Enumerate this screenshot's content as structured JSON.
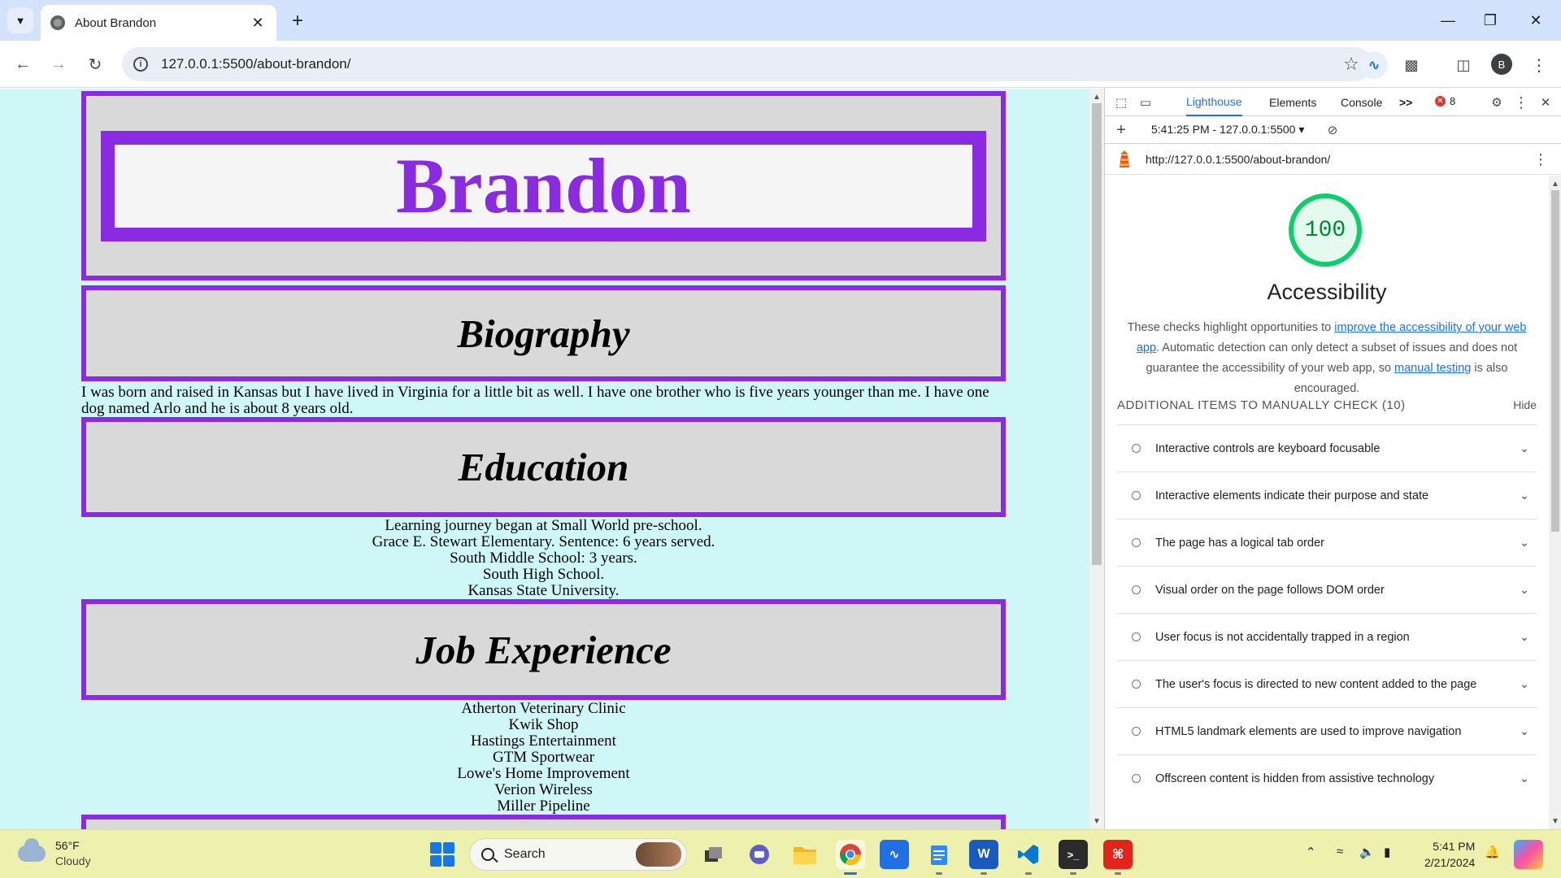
{
  "browser": {
    "tab_title": "About Brandon",
    "url": "127.0.0.1:5500/about-brandon/",
    "profile_initial": "B"
  },
  "page": {
    "site_title": "Brandon",
    "sections": {
      "biography": {
        "heading": "Biography",
        "text": "I was born and raised in Kansas but I have lived in Virginia for a little bit as well. I have one brother who is five years younger than me. I have one dog named Arlo and he is about 8 years old."
      },
      "education": {
        "heading": "Education",
        "lines": [
          "Learning journey began at Small World pre-school.",
          "Grace E. Stewart Elementary. Sentence: 6 years served.",
          "South Middle School: 3 years.",
          "South High School.",
          "Kansas State University."
        ]
      },
      "job_experience": {
        "heading": "Job Experience",
        "lines": [
          "Atherton Veterinary Clinic",
          "Kwik Shop",
          "Hastings Entertainment",
          "GTM Sportwear",
          "Lowe's Home Improvement",
          "Verion Wireless",
          "Miller Pipeline"
        ]
      }
    },
    "colors": {
      "background": "#cff7f7",
      "accent": "#8a2be2",
      "box": "#d9d9d9"
    }
  },
  "devtools": {
    "tabs": {
      "lighthouse": "Lighthouse",
      "elements": "Elements",
      "console": "Console",
      "more": ">>"
    },
    "error_count": "8",
    "report_select": "5:41:25 PM - 127.0.0.1:5500 ▾",
    "report_url": "http://127.0.0.1:5500/about-brandon/",
    "score": "100",
    "category_title": "Accessibility",
    "description": {
      "part1": "These checks highlight opportunities to ",
      "link1": "improve the accessibility of your web app",
      "part2": ". Automatic detection can only detect a subset of issues and does not guarantee the accessibility of your web app, so ",
      "link2": "manual testing",
      "part3": " is also encouraged."
    },
    "group_title": "ADDITIONAL ITEMS TO MANUALLY CHECK (10)",
    "hide_label": "Hide",
    "audits": [
      "Interactive controls are keyboard focusable",
      "Interactive elements indicate their purpose and state",
      "The page has a logical tab order",
      "Visual order on the page follows DOM order",
      "User focus is not accidentally trapped in a region",
      "The user's focus is directed to new content added to the page",
      "HTML5 landmark elements are used to improve navigation",
      "Offscreen content is hidden from assistive technology"
    ]
  },
  "taskbar": {
    "weather_temp": "56°F",
    "weather_condition": "Cloudy",
    "search_label": "Search",
    "time": "5:41 PM",
    "date": "2/21/2024"
  }
}
